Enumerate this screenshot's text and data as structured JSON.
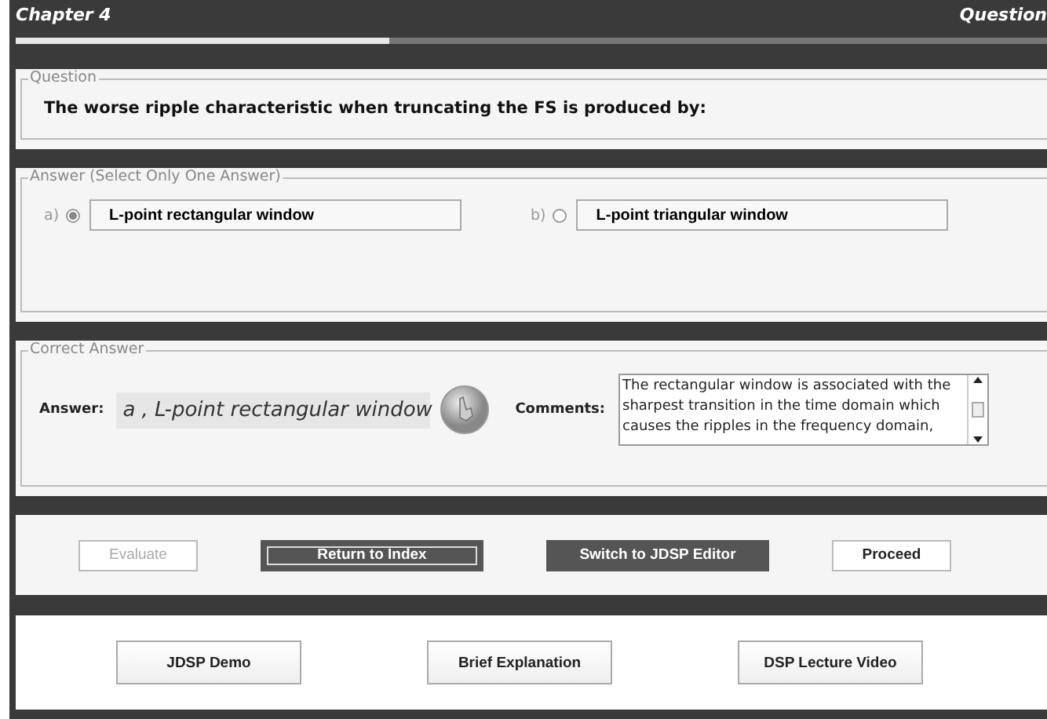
{
  "header": {
    "chapter": "Chapter 4",
    "question": "Question",
    "progress": {
      "level": 0.36
    }
  },
  "question": {
    "legend": "Question",
    "text": "The worse ripple characteristic when truncating the FS is produced by:"
  },
  "answers": {
    "legend": "Answer (Select Only One Answer)",
    "options": [
      {
        "letter": "a)",
        "label": "L-point rectangular window",
        "selected": true
      },
      {
        "letter": "b)",
        "label": "L-point triangular window",
        "selected": false
      }
    ]
  },
  "correct": {
    "legend": "Correct Answer",
    "answer_label": "Answer:",
    "answer": "a , L-point rectangular window",
    "comments_label": "Comments:",
    "comments": "The rectangular window is associated with the sharpest transition in the time domain which causes the ripples in the frequency domain,"
  },
  "actions": [
    {
      "label": "Evaluate",
      "kind": "plain",
      "disabled": true,
      "focused": false
    },
    {
      "label": "Return to Index",
      "kind": "dark",
      "disabled": false,
      "focused": true
    },
    {
      "label": "Switch to JDSP Editor",
      "kind": "dark",
      "disabled": false,
      "focused": false
    },
    {
      "label": "Proceed",
      "kind": "plain",
      "disabled": false,
      "focused": false
    }
  ],
  "resources": [
    "JDSP Demo",
    "Brief Explanation",
    "DSP Lecture Video"
  ]
}
